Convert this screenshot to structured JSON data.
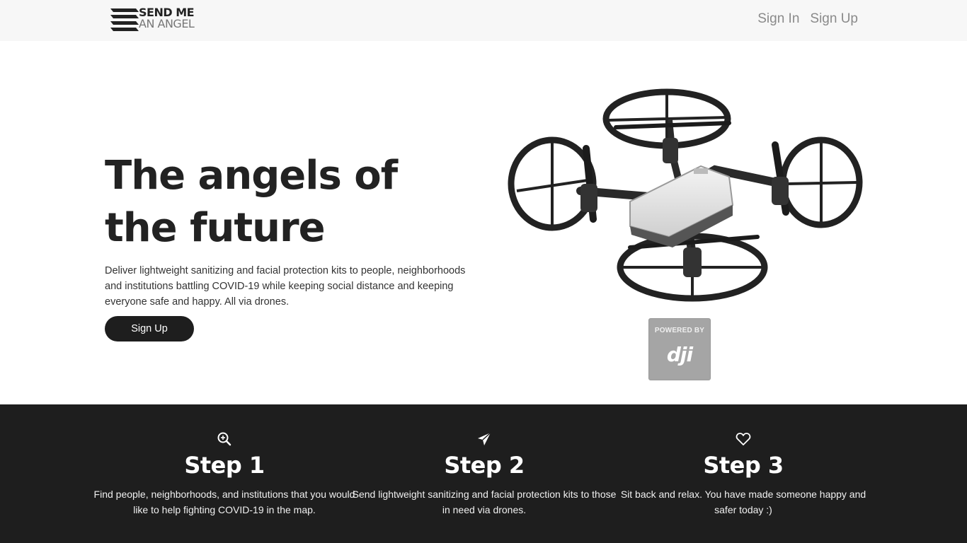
{
  "header": {
    "logo_line1": "SEND ME",
    "logo_line2": "AN ANGEL",
    "sign_in": "Sign In",
    "sign_up": "Sign Up"
  },
  "hero": {
    "title": "The angels of the future",
    "description": "Deliver lightweight sanitizing and facial protection kits to people, neighborhoods and institutions battling COVID-19 while keeping social distance and keeping everyone safe and happy. All via drones.",
    "button_label": "Sign Up",
    "badge_powered_by": "POWERED BY",
    "badge_brand": "dji"
  },
  "steps": [
    {
      "icon": "search-icon",
      "title": "Step 1",
      "text": "Find people, neighborhoods, and institutions that you would like to help fighting COVID-19 in the map."
    },
    {
      "icon": "send-icon",
      "title": "Step 2",
      "text": "Send lightweight sanitizing and facial protection kits to those in need via drones."
    },
    {
      "icon": "heart-icon",
      "title": "Step 3",
      "text": "Sit back and relax. You have made someone happy and safer today :)"
    }
  ],
  "colors": {
    "dark": "#1e1e1e",
    "nav_bg": "#f7f7f7",
    "nav_link": "#8a8a8a",
    "badge": "#a5a5a5"
  }
}
